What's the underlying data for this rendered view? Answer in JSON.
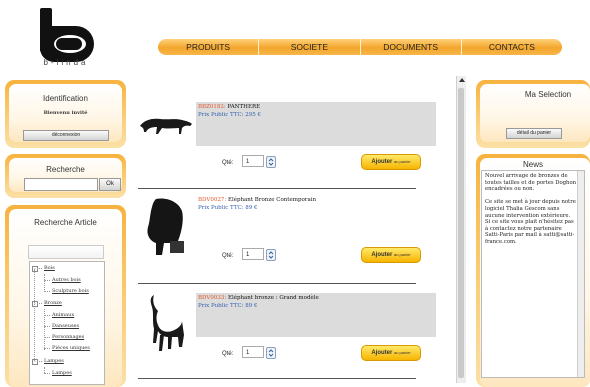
{
  "logo": {
    "text": "b-linda"
  },
  "nav": [
    "PRODUITS",
    "SOCIETE",
    "DOCUMENTS",
    "CONTACTS"
  ],
  "identification": {
    "title": "Identification",
    "welcome": "Bienvenu invité",
    "logout": "déconnexion"
  },
  "search": {
    "title": "Recherche",
    "value": "",
    "button": "Ok"
  },
  "advanced": {
    "title": "Recherche Article",
    "tree": [
      {
        "label": "Bois",
        "level": 0,
        "toggle": "-"
      },
      {
        "label": "Autres bois",
        "level": 1
      },
      {
        "label": "Sculpture bois",
        "level": 1
      },
      {
        "label": "Bronze",
        "level": 0,
        "toggle": "-"
      },
      {
        "label": "Animaux",
        "level": 1
      },
      {
        "label": "Danseuses",
        "level": 1
      },
      {
        "label": "Personnages",
        "level": 1
      },
      {
        "label": "Pièces uniques",
        "level": 1
      },
      {
        "label": "Lampes",
        "level": 0,
        "toggle": "-"
      },
      {
        "label": "Lampes",
        "level": 1
      }
    ]
  },
  "products": [
    {
      "ref": "BBZ0182:",
      "name": "PANTHERE",
      "price": "Prix Public TTC: 295 €",
      "qty_label": "Qté:",
      "qty": "1",
      "add_label": "Ajouter",
      "add_suffix": "au panier",
      "icon": "panther-statue-icon"
    },
    {
      "ref": "BDV0027:",
      "name": "Eléphant Bronze Contemporain",
      "price": "Prix Public TTC: 89 €",
      "qty_label": "Qté:",
      "qty": "1",
      "add_label": "Ajouter",
      "add_suffix": "au panier",
      "icon": "elephant-statue-icon"
    },
    {
      "ref": "BDV0033:",
      "name": "Eléphant bronze : Grand modèle",
      "price": "Prix Public TTC: 89 €",
      "qty_label": "Qté:",
      "qty": "1",
      "add_label": "Ajouter",
      "add_suffix": "au panier",
      "icon": "elephant-trunk-up-icon"
    }
  ],
  "selection": {
    "title": "Ma Selection",
    "button": "détail du panier"
  },
  "news": {
    "title": "News",
    "text": "Nouvel arrivage de bronzes de toutes tailles et de portes Doghon encadrées ou non.\n\nCe site se met à jour depuis notre logiciel Thalia Gescom sans aucune intervention extérieure. Si ce site vous plait n'hésitez pas à contactez notre partenaire Satti-Paris par mail à satti@satti-france.com."
  },
  "colors": {
    "accent": "#f3a62c",
    "ref": "#e3582c",
    "price": "#3360b0"
  }
}
